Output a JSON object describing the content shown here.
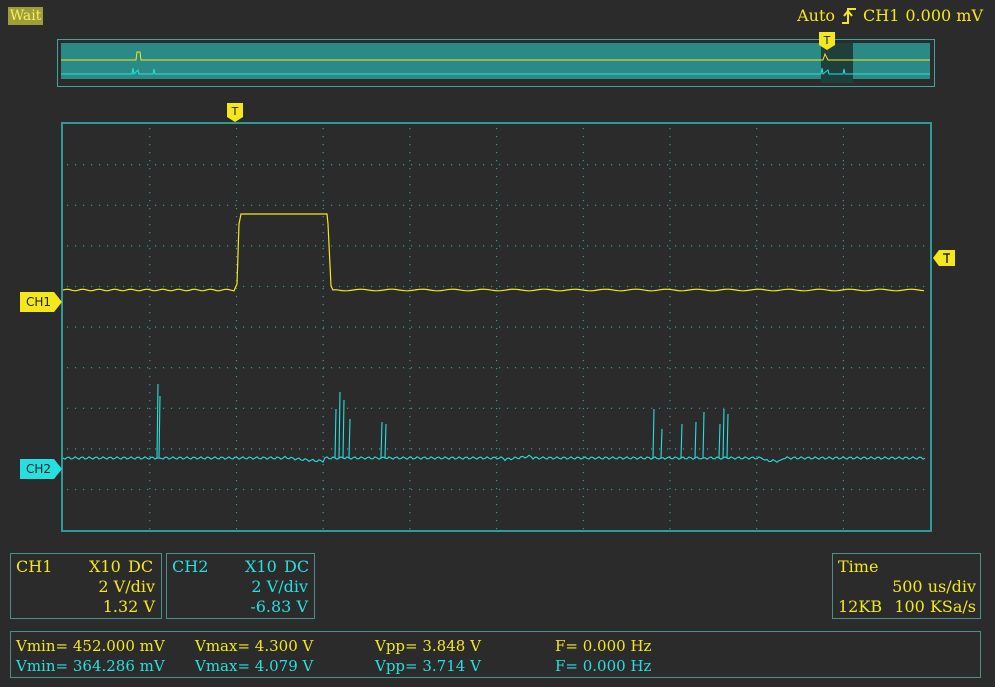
{
  "status": "Wait",
  "trigger": {
    "mode": "Auto",
    "edge_icon": "rising-edge-icon",
    "source": "CH1",
    "level": "0.000 mV"
  },
  "trigger_marker": "T",
  "channel_markers": {
    "ch1": "CH1",
    "ch2": "CH2"
  },
  "colors": {
    "ch1": "#f4e81c",
    "ch2": "#26e0e0",
    "grid": "#2e9c96",
    "bg": "#2b2b2b"
  },
  "ch1_info": {
    "name": "CH1",
    "probe": "X10",
    "coupling": "DC",
    "scale": "2 V/div",
    "offset": "1.32 V"
  },
  "ch2_info": {
    "name": "CH2",
    "probe": "X10",
    "coupling": "DC",
    "scale": "2 V/div",
    "offset": "-6.83 V"
  },
  "time_info": {
    "label": "Time",
    "timebase": "500 us/div",
    "memory": "12KB",
    "sample_rate": "100 KSa/s"
  },
  "measurements": {
    "ch1": {
      "vmin": "Vmin= 452.000 mV",
      "vmax": "Vmax= 4.300 V",
      "vpp": "Vpp= 3.848 V",
      "freq": "F= 0.000 Hz"
    },
    "ch2": {
      "vmin": "Vmin= 364.286 mV",
      "vmax": "Vmax= 4.079 V",
      "vpp": "Vpp= 3.714 V",
      "freq": "F= 0.000 Hz"
    }
  }
}
